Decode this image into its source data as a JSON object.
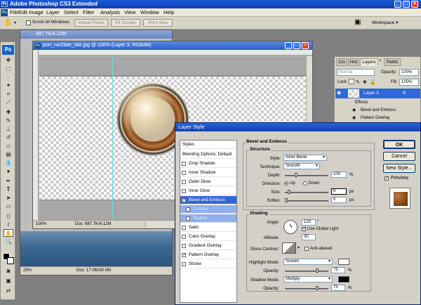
{
  "window": {
    "title": "Adobe Photoshop CS3 Extended",
    "app_logo": "Ps"
  },
  "menubar": [
    "File",
    "Edit",
    "Image",
    "Layer",
    "Select",
    "Filter",
    "Analysis",
    "View",
    "Window",
    "Help"
  ],
  "options": {
    "scroll_all": "Scroll All Windows",
    "actual_pixels": "Actual Pixels",
    "fit_screen": "Fit Screen",
    "print_size": "Print Size",
    "workspace": "Workspace ▾"
  },
  "doc_main": {
    "title": "port_nvr2late_site.jpg @ 100% (Layer 3, RGB/8#)",
    "zoom": "100%",
    "doc_size": "Doc: 687.7K/4.12M"
  },
  "doc_back": {
    "title_fragment": "... 687.7K/4.12M",
    "zoom": "25%",
    "doc_size": "Doc: 17.0M/30.0M"
  },
  "layers_panel": {
    "tabs": [
      "Clo",
      "Hist",
      "Layers",
      "Paths"
    ],
    "blend_mode": "Normal",
    "opacity_label": "Opacity:",
    "opacity_value": "100%",
    "lock_label": "Lock:",
    "fill_label": "Fill:",
    "fill_value": "100%",
    "layer_name": "Layer 3",
    "fx_label": "fx",
    "effects": [
      "Effects",
      "Bevel and Emboss",
      "Pattern Overlay"
    ]
  },
  "dialog": {
    "title": "Layer Style",
    "styles_header": "Styles",
    "blending": "Blending Options: Default",
    "list": [
      {
        "label": "Drop Shadow",
        "checked": false
      },
      {
        "label": "Inner Shadow",
        "checked": false
      },
      {
        "label": "Outer Glow",
        "checked": false
      },
      {
        "label": "Inner Glow",
        "checked": false
      },
      {
        "label": "Bevel and Emboss",
        "checked": true
      },
      {
        "label": "Contour",
        "checked": false
      },
      {
        "label": "Texture",
        "checked": false
      },
      {
        "label": "Satin",
        "checked": false
      },
      {
        "label": "Color Overlay",
        "checked": false
      },
      {
        "label": "Gradient Overlay",
        "checked": false
      },
      {
        "label": "Pattern Overlay",
        "checked": true
      },
      {
        "label": "Stroke",
        "checked": false
      }
    ],
    "section_title": "Bevel and Emboss",
    "structure": {
      "title": "Structure",
      "style_label": "Style:",
      "style_value": "Inner Bevel",
      "technique_label": "Technique:",
      "technique_value": "Smooth",
      "depth_label": "Depth:",
      "depth_value": "100",
      "depth_unit": "%",
      "direction_label": "Direction:",
      "dir_up": "Up",
      "dir_down": "Down",
      "size_label": "Size:",
      "size_value": "6",
      "size_unit": "px",
      "soften_label": "Soften:",
      "soften_value": "0",
      "soften_unit": "px"
    },
    "shading": {
      "title": "Shading",
      "angle_label": "Angle:",
      "angle_value": "120",
      "angle_unit": "°",
      "global_light": "Use Global Light",
      "altitude_label": "Altitude:",
      "altitude_value": "30",
      "gloss_label": "Gloss Contour:",
      "anti_aliased": "Anti-aliased",
      "highlight_label": "Highlight Mode:",
      "highlight_value": "Screen",
      "hl_opacity_label": "Opacity:",
      "hl_opacity_value": "75",
      "hl_opacity_unit": "%",
      "shadow_label": "Shadow Mode:",
      "shadow_value": "Multiply",
      "sh_opacity_label": "Opacity:",
      "sh_opacity_value": "75",
      "sh_opacity_unit": "%"
    },
    "buttons": {
      "ok": "OK",
      "cancel": "Cancel",
      "new_style": "New Style...",
      "preview": "Preview"
    }
  },
  "colors": {
    "accent": "#0f3fae",
    "selection": "#3168d5",
    "bronze": "#8a4a1c"
  }
}
